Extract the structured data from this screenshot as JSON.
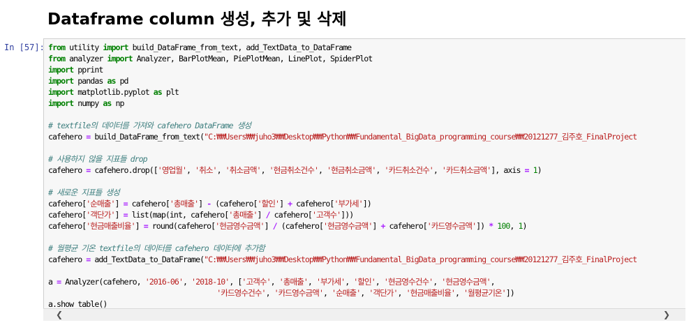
{
  "heading": "Dataframe column 생성, 추가 및 삭제",
  "cell": {
    "prompt": "In [57]:",
    "lines": [
      [
        {
          "t": "from",
          "c": "kw"
        },
        {
          "t": " utility "
        },
        {
          "t": "import",
          "c": "kw"
        },
        {
          "t": " build_DataFrame_from_text, add_TextData_to_DataFrame"
        }
      ],
      [
        {
          "t": "from",
          "c": "kw"
        },
        {
          "t": " analyzer "
        },
        {
          "t": "import",
          "c": "kw"
        },
        {
          "t": " Analyzer, BarPlotMean, PiePlotMean, LinePlot, SpiderPlot"
        }
      ],
      [
        {
          "t": "import",
          "c": "kw"
        },
        {
          "t": " pprint"
        }
      ],
      [
        {
          "t": "import",
          "c": "kw"
        },
        {
          "t": " pandas "
        },
        {
          "t": "as",
          "c": "kw"
        },
        {
          "t": " pd"
        }
      ],
      [
        {
          "t": "import",
          "c": "kw"
        },
        {
          "t": " matplotlib.pyplot "
        },
        {
          "t": "as",
          "c": "kw"
        },
        {
          "t": " plt"
        }
      ],
      [
        {
          "t": "import",
          "c": "kw"
        },
        {
          "t": " numpy "
        },
        {
          "t": "as",
          "c": "kw"
        },
        {
          "t": " np"
        }
      ],
      [],
      [
        {
          "t": "# textfile의 데이터를 가져와 cafehero DataFrame 생성",
          "c": "cm"
        }
      ],
      [
        {
          "t": "cafehero "
        },
        {
          "t": "=",
          "c": "op"
        },
        {
          "t": " build_DataFrame_from_text("
        },
        {
          "t": "\"C:₩₩Users₩₩juho3₩₩Desktop₩₩Python₩₩Fundamental_BigData_programming_course₩₩20121277_김주호_FinalProject",
          "c": "st"
        }
      ],
      [],
      [
        {
          "t": "# 사용하지 않을 지표들 drop",
          "c": "cm"
        }
      ],
      [
        {
          "t": "cafehero "
        },
        {
          "t": "=",
          "c": "op"
        },
        {
          "t": " cafehero.drop(["
        },
        {
          "t": "'영업월'",
          "c": "st"
        },
        {
          "t": ", "
        },
        {
          "t": "'취소'",
          "c": "st"
        },
        {
          "t": ", "
        },
        {
          "t": "'취소금액'",
          "c": "st"
        },
        {
          "t": ", "
        },
        {
          "t": "'현금취소건수'",
          "c": "st"
        },
        {
          "t": ", "
        },
        {
          "t": "'현금취소금액'",
          "c": "st"
        },
        {
          "t": ", "
        },
        {
          "t": "'카드취소건수'",
          "c": "st"
        },
        {
          "t": ", "
        },
        {
          "t": "'카드취소금액'",
          "c": "st"
        },
        {
          "t": "], axis "
        },
        {
          "t": "=",
          "c": "op"
        },
        {
          "t": " "
        },
        {
          "t": "1",
          "c": "nu"
        },
        {
          "t": ")"
        }
      ],
      [],
      [
        {
          "t": "# 새로운 지표들 생성",
          "c": "cm"
        }
      ],
      [
        {
          "t": "cafehero["
        },
        {
          "t": "'순매출'",
          "c": "st"
        },
        {
          "t": "] "
        },
        {
          "t": "=",
          "c": "op"
        },
        {
          "t": " cafehero["
        },
        {
          "t": "'총매출'",
          "c": "st"
        },
        {
          "t": "] "
        },
        {
          "t": "-",
          "c": "op"
        },
        {
          "t": " (cafehero["
        },
        {
          "t": "'할인'",
          "c": "st"
        },
        {
          "t": "] "
        },
        {
          "t": "+",
          "c": "op"
        },
        {
          "t": " cafehero["
        },
        {
          "t": "'부가세'",
          "c": "st"
        },
        {
          "t": "])"
        }
      ],
      [
        {
          "t": "cafehero["
        },
        {
          "t": "'객단가'",
          "c": "st"
        },
        {
          "t": "] "
        },
        {
          "t": "=",
          "c": "op"
        },
        {
          "t": " list(map(int, cafehero["
        },
        {
          "t": "'총매출'",
          "c": "st"
        },
        {
          "t": "] "
        },
        {
          "t": "/",
          "c": "op"
        },
        {
          "t": " cafehero["
        },
        {
          "t": "'고객수'",
          "c": "st"
        },
        {
          "t": "]))"
        }
      ],
      [
        {
          "t": "cafehero["
        },
        {
          "t": "'현금매출비율'",
          "c": "st"
        },
        {
          "t": "] "
        },
        {
          "t": "=",
          "c": "op"
        },
        {
          "t": " round(cafehero["
        },
        {
          "t": "'현금영수금액'",
          "c": "st"
        },
        {
          "t": "] "
        },
        {
          "t": "/",
          "c": "op"
        },
        {
          "t": " (cafehero["
        },
        {
          "t": "'현금영수금액'",
          "c": "st"
        },
        {
          "t": "] "
        },
        {
          "t": "+",
          "c": "op"
        },
        {
          "t": " cafehero["
        },
        {
          "t": "'카드영수금액'",
          "c": "st"
        },
        {
          "t": "]) "
        },
        {
          "t": "*",
          "c": "op"
        },
        {
          "t": " "
        },
        {
          "t": "100",
          "c": "nu"
        },
        {
          "t": ", "
        },
        {
          "t": "1",
          "c": "nu"
        },
        {
          "t": ")"
        }
      ],
      [],
      [
        {
          "t": "# 월평균 기온 textfile의 데이터를 cafehero 데이터에 추가함",
          "c": "cm"
        }
      ],
      [
        {
          "t": "cafehero "
        },
        {
          "t": "=",
          "c": "op"
        },
        {
          "t": " add_TextData_to_DataFrame("
        },
        {
          "t": "\"C:₩₩Users₩₩juho3₩₩Desktop₩₩Python₩₩Fundamental_BigData_programming_course₩₩20121277_김주호_FinalProject",
          "c": "st"
        }
      ],
      [],
      [
        {
          "t": "a "
        },
        {
          "t": "=",
          "c": "op"
        },
        {
          "t": " Analyzer(cafehero, "
        },
        {
          "t": "'2016-06'",
          "c": "st"
        },
        {
          "t": ", "
        },
        {
          "t": "'2018-10'",
          "c": "st"
        },
        {
          "t": ", ["
        },
        {
          "t": "'고객수'",
          "c": "st"
        },
        {
          "t": ", "
        },
        {
          "t": "'총매출'",
          "c": "st"
        },
        {
          "t": ", "
        },
        {
          "t": "'부가세'",
          "c": "st"
        },
        {
          "t": ", "
        },
        {
          "t": "'할인'",
          "c": "st"
        },
        {
          "t": ", "
        },
        {
          "t": "'현금영수건수'",
          "c": "st"
        },
        {
          "t": ", "
        },
        {
          "t": "'현금영수금액'",
          "c": "st"
        },
        {
          "t": ","
        }
      ],
      [
        {
          "t": "                                        "
        },
        {
          "t": "'카드영수건수'",
          "c": "st"
        },
        {
          "t": ", "
        },
        {
          "t": "'카드영수금액'",
          "c": "st"
        },
        {
          "t": ", "
        },
        {
          "t": "'순매출'",
          "c": "st"
        },
        {
          "t": ", "
        },
        {
          "t": "'객단가'",
          "c": "st"
        },
        {
          "t": ", "
        },
        {
          "t": "'현금매출비율'",
          "c": "st"
        },
        {
          "t": ", "
        },
        {
          "t": "'월평균기온'",
          "c": "st"
        },
        {
          "t": "])"
        }
      ],
      [
        {
          "t": "a.show_table()"
        }
      ]
    ]
  },
  "scrollbar": {
    "left_arrow": "❮",
    "right_arrow": "❯"
  }
}
